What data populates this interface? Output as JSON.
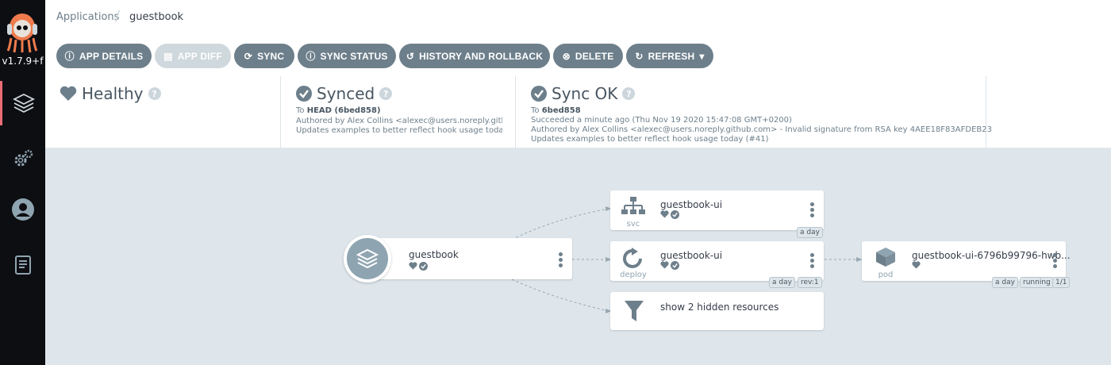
{
  "app": {
    "version": "v1.7.9+f",
    "colors": {
      "sidebar": "#0d0e12",
      "button": "#6d7f8b",
      "healthy": "#6d7f8b",
      "canvas": "#dee6eb"
    }
  },
  "breadcrumb": {
    "root": "Applications",
    "current": "guestbook"
  },
  "toolbar": {
    "app_details": "APP DETAILS",
    "app_diff": "APP DIFF",
    "sync": "SYNC",
    "sync_status": "SYNC STATUS",
    "history": "HISTORY AND ROLLBACK",
    "delete": "DELETE",
    "refresh": "REFRESH"
  },
  "status": {
    "health": {
      "label": "Healthy"
    },
    "sync": {
      "label": "Synced",
      "to_prefix": "To",
      "to_value": "HEAD (6bed858)",
      "author": "Authored by Alex Collins <alexec@users.noreply.gith...",
      "message": "Updates examples to better reflect hook usage toda..."
    },
    "operation": {
      "label": "Sync OK",
      "to_prefix": "To",
      "to_value": "6bed858",
      "succeeded": "Succeeded a minute ago (Thu Nov 19 2020 15:47:08 GMT+0200)",
      "author": "Authored by Alex Collins <alexec@users.noreply.github.com> - Invalid signature from RSA key 4AEE18F83AFDEB23",
      "message": "Updates examples to better reflect hook usage today (#41)"
    }
  },
  "tree": {
    "root": {
      "name": "guestbook"
    },
    "svc": {
      "name": "guestbook-ui",
      "kind": "svc",
      "tags": [
        "a day"
      ]
    },
    "deploy": {
      "name": "guestbook-ui",
      "kind": "deploy",
      "tags": [
        "a day",
        "rev:1"
      ]
    },
    "hidden": {
      "name": "show 2 hidden resources"
    },
    "pod": {
      "name": "guestbook-ui-6796b99796-hwb...",
      "kind": "pod",
      "tags": [
        "a day",
        "running",
        "1/1"
      ]
    }
  }
}
